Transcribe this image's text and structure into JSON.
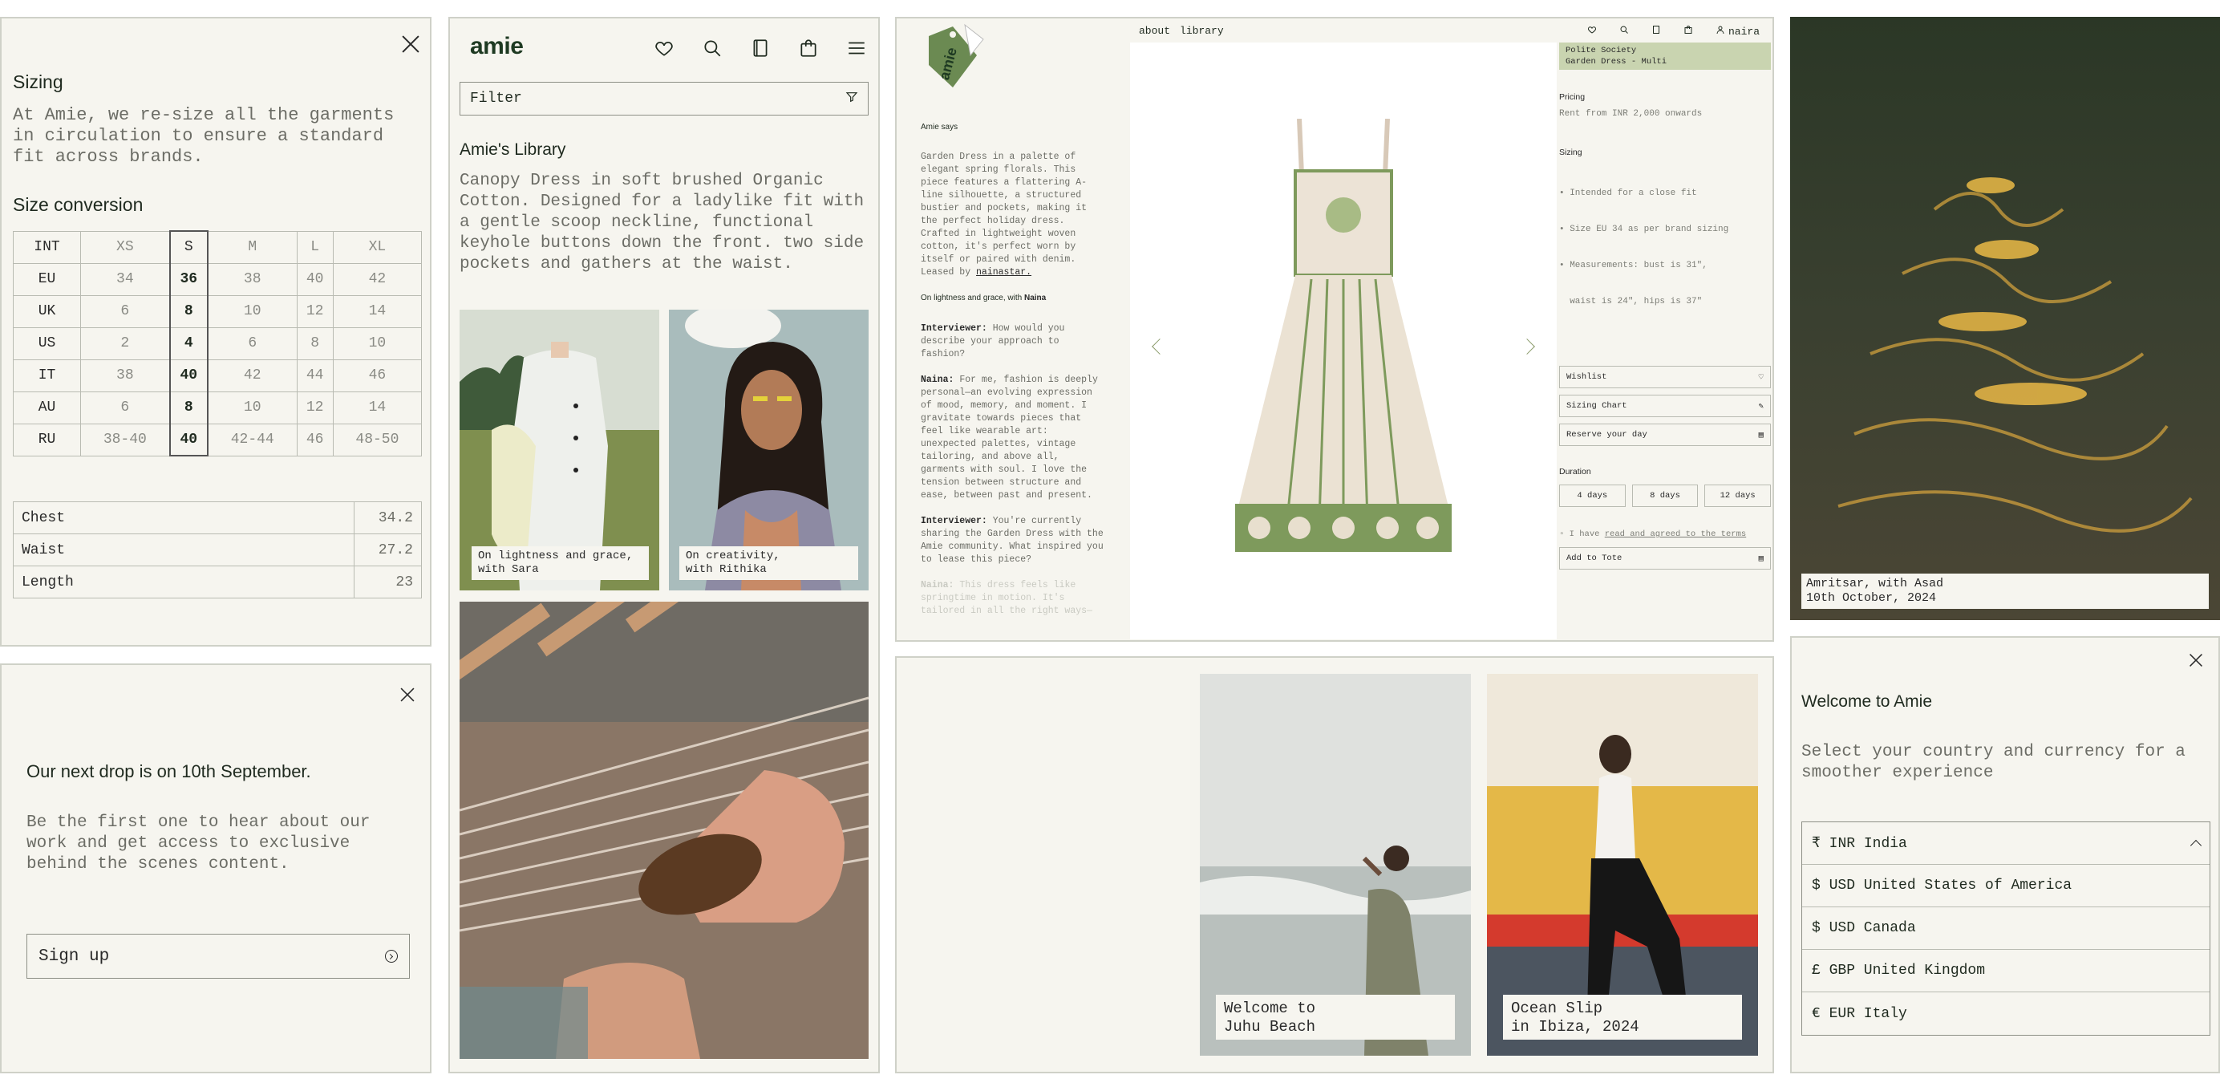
{
  "sizing": {
    "title": "Sizing",
    "intro": "At Amie, we re-size all the garments in circulation to ensure a standard fit across brands.",
    "conversion_title": "Size conversion",
    "table": [
      [
        "INT",
        "XS",
        "S",
        "M",
        "L",
        "XL"
      ],
      [
        "EU",
        "34",
        "36",
        "38",
        "40",
        "42"
      ],
      [
        "UK",
        "6",
        "8",
        "10",
        "12",
        "14"
      ],
      [
        "US",
        "2",
        "4",
        "6",
        "8",
        "10"
      ],
      [
        "IT",
        "38",
        "40",
        "42",
        "44",
        "46"
      ],
      [
        "AU",
        "6",
        "8",
        "10",
        "12",
        "14"
      ],
      [
        "RU",
        "38-40",
        "40",
        "42-44",
        "46",
        "48-50"
      ]
    ],
    "selected_size": "S",
    "measurements": [
      {
        "label": "Chest",
        "value": "34.2"
      },
      {
        "label": "Waist",
        "value": "27.2"
      },
      {
        "label": "Length",
        "value": "23"
      }
    ]
  },
  "drop": {
    "title": "Our next drop is on 10th September.",
    "body": "Be the first one to hear about our work and get access to exclusive behind the scenes content.",
    "signup_label": "Sign up"
  },
  "library": {
    "logo": "amie",
    "filter_label": "Filter",
    "title": "Amie's Library",
    "description": "Canopy Dress in soft brushed Organic Cotton. Designed for a ladylike fit  with a gentle scoop neckline, functional keyhole buttons down the  front. two side pockets and gathers at the waist.",
    "cards": [
      {
        "caption": "On lightness and grace,\nwith Sara"
      },
      {
        "caption": "On creativity,\nwith Rithika"
      }
    ]
  },
  "product": {
    "tag_text": "amie",
    "nav": [
      "about",
      "library"
    ],
    "user": "naira",
    "amie_says": "Amie says",
    "story_intro": "Garden Dress in a palette of elegant spring florals. This piece features a flattering A-line silhouette, a structured bustier and pockets, making it the perfect holiday dress. Crafted in lightweight woven cotton, it's perfect worn by itself or paired with denim. Leased by",
    "story_lessor": "nainastar.",
    "story_heading_pre": "On lightness and grace, with",
    "story_heading_name": "Naina",
    "qa": [
      {
        "who": "Interviewer:",
        "text": "How would you describe your approach to fashion?"
      },
      {
        "who": "Naina:",
        "text": "For me, fashion is deeply personal—an evolving expression of mood, memory, and moment. I gravitate towards pieces that feel like wearable art: unexpected palettes, vintage tailoring, and above all, garments with soul. I love the tension between structure and ease, between past and present."
      },
      {
        "who": "Interviewer:",
        "text": "You're currently sharing the Garden Dress with the Amie community. What inspired you to lease this piece?"
      },
      {
        "who": "Naina:",
        "text": "This dress feels like springtime in motion. It's tailored in all the right ways—"
      }
    ],
    "brand_line1": "Polite Society",
    "brand_line2": "Garden Dress - Multi",
    "pricing_label": "Pricing",
    "pricing_text": "Rent from INR 2,000 onwards",
    "sizing_label": "Sizing",
    "sizing_points": [
      "• Intended for a close fit",
      "• Size EU 34 as per brand sizing",
      "• Measurements: bust is 31\",",
      "  waist is 24\", hips is 37\""
    ],
    "wishlist_label": "Wishlist",
    "sizing_chart_label": "Sizing Chart",
    "reserve_label": "Reserve your day",
    "duration_label": "Duration",
    "durations": [
      "4 days",
      "8 days",
      "12 days"
    ],
    "terms_pre": "I have",
    "terms_link": "read and agreed to the terms",
    "add_to_tote": "Add to Tote"
  },
  "beach": {
    "cards": [
      {
        "caption": "Welcome to\nJuhu Beach"
      },
      {
        "caption": "Ocean Slip\nin Ibiza, 2024"
      }
    ]
  },
  "amritsar": {
    "line1": "Amritsar, with Asad",
    "line2": "10th October, 2024"
  },
  "welcome": {
    "title": "Welcome to Amie",
    "body": "Select your country and currency for a smoother experience",
    "options": [
      "₹ INR India",
      "$ USD United States of America",
      "$ USD Canada",
      "£ GBP United Kingdom",
      "€ EUR Italy"
    ]
  }
}
